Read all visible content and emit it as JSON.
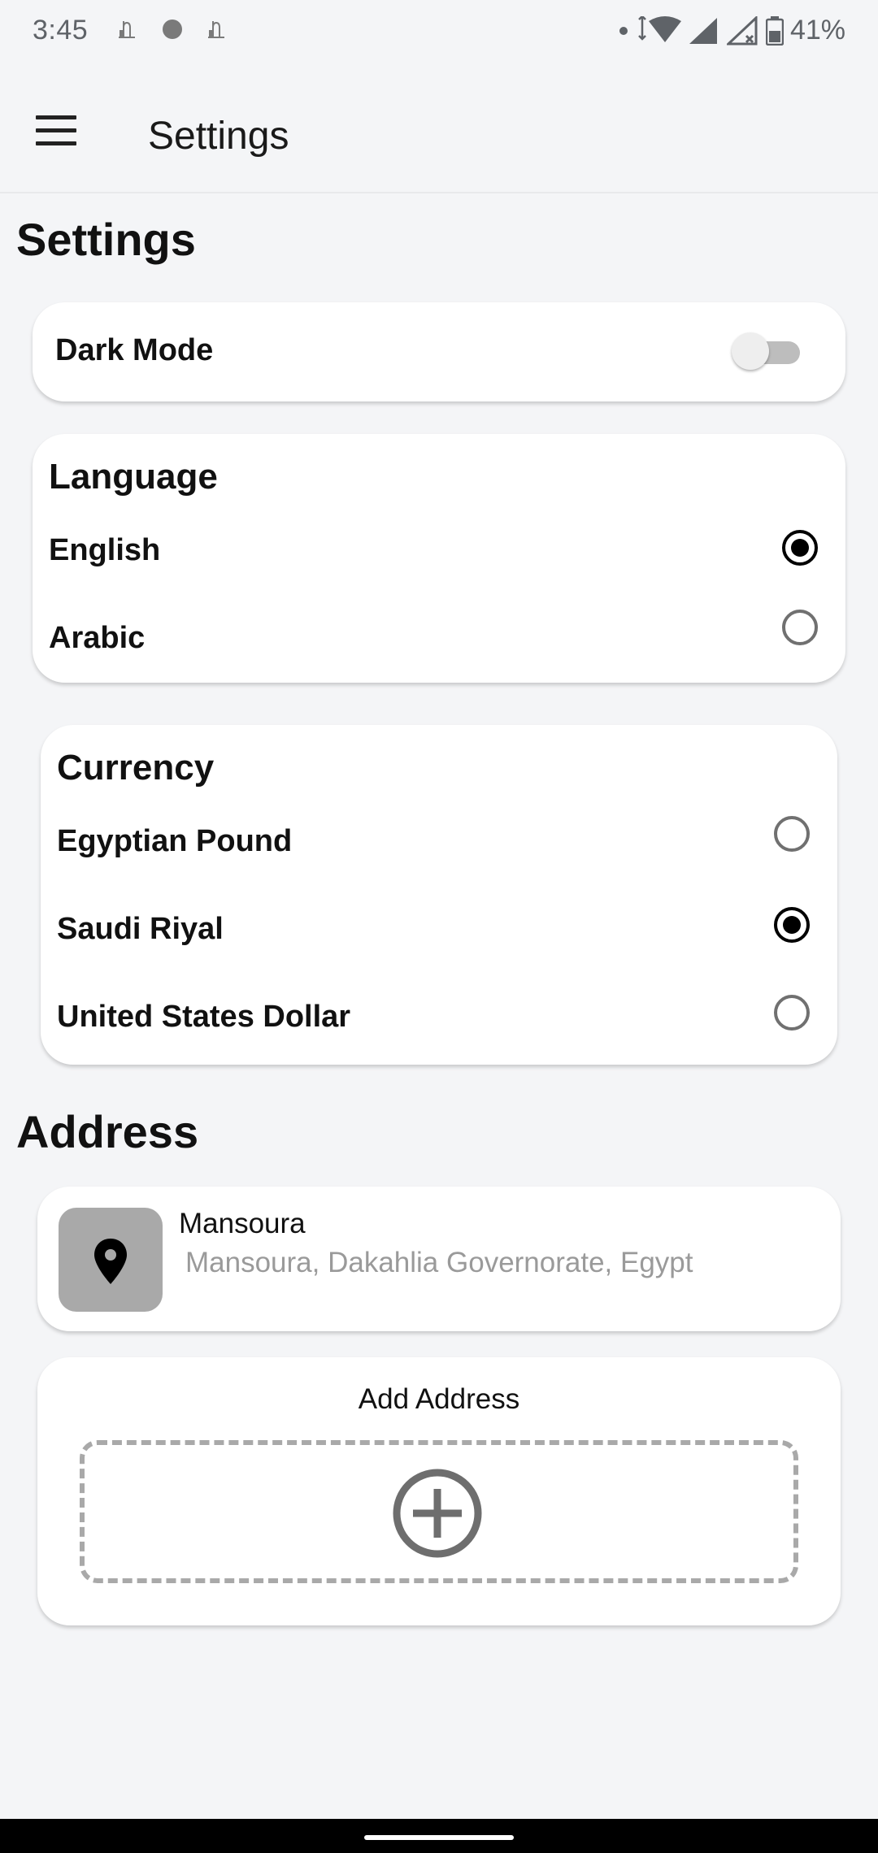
{
  "status_bar": {
    "time": "3:45",
    "battery": "41%",
    "notification_icons": [
      "mosque-icon",
      "circle-icon",
      "mosque-icon"
    ]
  },
  "app_bar": {
    "title": "Settings",
    "menu_icon": "hamburger-menu-icon"
  },
  "page": {
    "title": "Settings"
  },
  "dark_mode": {
    "label": "Dark Mode",
    "enabled": false
  },
  "language": {
    "title": "Language",
    "options": [
      {
        "label": "English",
        "selected": true
      },
      {
        "label": "Arabic",
        "selected": false
      }
    ]
  },
  "currency": {
    "title": "Currency",
    "options": [
      {
        "label": "Egyptian Pound",
        "selected": false
      },
      {
        "label": "Saudi Riyal",
        "selected": true
      },
      {
        "label": "United States Dollar",
        "selected": false
      }
    ]
  },
  "address": {
    "title": "Address",
    "items": [
      {
        "name": "Mansoura",
        "detail": "Mansoura, Dakahlia Governorate, Egypt",
        "icon": "location-pin-icon"
      }
    ],
    "add_label": "Add Address",
    "add_icon": "add-circle-icon"
  },
  "colors": {
    "background": "#f4f5f7",
    "card": "#ffffff",
    "accent": "#000000",
    "pin_box": "#a9a9a9"
  }
}
